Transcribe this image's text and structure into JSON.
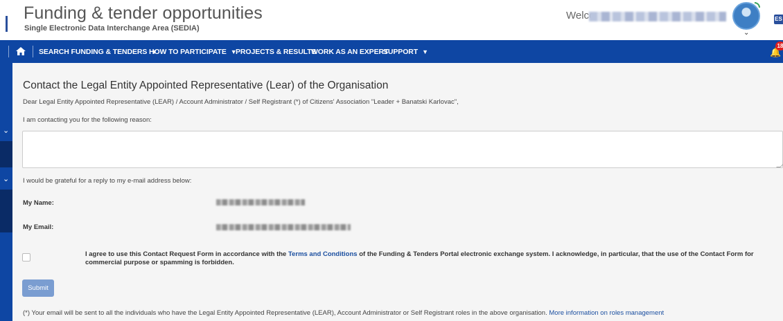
{
  "header": {
    "title": "Funding & tender opportunities",
    "subtitle": "Single Electronic Data Interchange Area (SEDIA)",
    "welcome": "Welcome",
    "language_badge": "ES"
  },
  "nav": {
    "home_icon": "home-icon",
    "items": [
      {
        "label": "SEARCH FUNDING & TENDERS",
        "has_dropdown": true
      },
      {
        "label": "HOW TO PARTICIPATE",
        "has_dropdown": true
      },
      {
        "label": "PROJECTS & RESULTS",
        "has_dropdown": false
      },
      {
        "label": "WORK AS AN EXPERT",
        "has_dropdown": false
      },
      {
        "label": "SUPPORT",
        "has_dropdown": true
      }
    ],
    "notification_count": "18"
  },
  "form": {
    "heading": "Contact the Legal Entity Appointed Representative (Lear) of the Organisation",
    "greeting": "Dear Legal Entity Appointed Representative (LEAR) / Account Administrator / Self Registrant (*) of Citizens' Association \"Leader + Banatski Karlovac\",",
    "reason_prompt": "I am contacting you for the following reason:",
    "reason_value": "",
    "reply_prompt": "I would be grateful for a reply to my e-mail address below:",
    "name_label": "My Name:",
    "email_label": "My Email:",
    "agree_text_before": "I agree to use this Contact Request Form in accordance with the",
    "agree_link": "Terms and Conditions",
    "agree_text_after": "of the Funding & Tenders Portal electronic exchange system. I acknowledge, in particular, that the use of the Contact Form for commercial purpose or spamming is forbidden.",
    "submit_label": "Submit",
    "footnote_text": "(*) Your email will be sent to all the individuals who have the Legal Entity Appointed Representative (LEAR), Account Administrator or Self Registrant roles in the above organisation.",
    "footnote_link": "More information on roles management"
  },
  "colors": {
    "nav_blue": "#0e46a3",
    "link_blue": "#1b4fa0",
    "submit_disabled": "#7a9dd1",
    "badge_red": "#e02020"
  }
}
